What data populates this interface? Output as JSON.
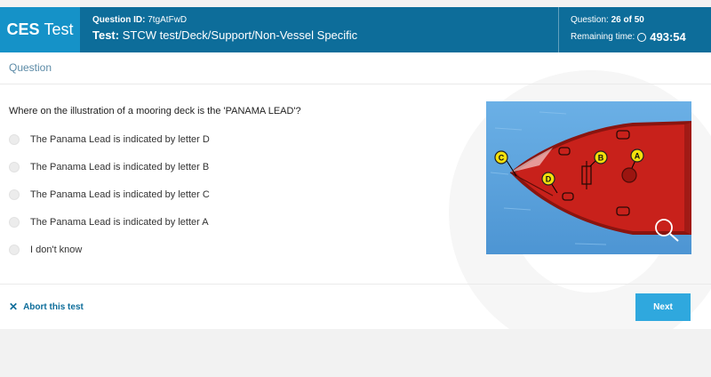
{
  "header": {
    "logo_bold": "CES",
    "logo_regular": "Test",
    "question_id_label": "Question ID:",
    "question_id": "7tgAtFwD",
    "test_label": "Test:",
    "test_name": "STCW test/Deck/Support/Non-Vessel Specific",
    "question_label": "Question:",
    "question_counter": "26 of 50",
    "remaining_label": "Remaining time:",
    "remaining_time": "493:54"
  },
  "main": {
    "section_label": "Question",
    "question_text": "Where on the illustration of a mooring deck is the 'PANAMA LEAD'?",
    "options": [
      {
        "label": "The Panama Lead is indicated by letter D"
      },
      {
        "label": "The Panama Lead is indicated by letter B"
      },
      {
        "label": "The Panama Lead is indicated by letter C"
      },
      {
        "label": "The Panama Lead is indicated by letter A"
      },
      {
        "label": "I don't know"
      }
    ],
    "illustration": {
      "markers": [
        "C",
        "B",
        "A",
        "D"
      ],
      "colors": {
        "water": "#5aa2dd",
        "deck": "#c8211b",
        "marker": "#f4e00c"
      }
    }
  },
  "footer": {
    "abort_label": "Abort this test",
    "next_label": "Next"
  },
  "colors": {
    "header_bg": "#0d6d9a",
    "logo_bg": "#1592c8",
    "accent": "#2fa8de"
  }
}
